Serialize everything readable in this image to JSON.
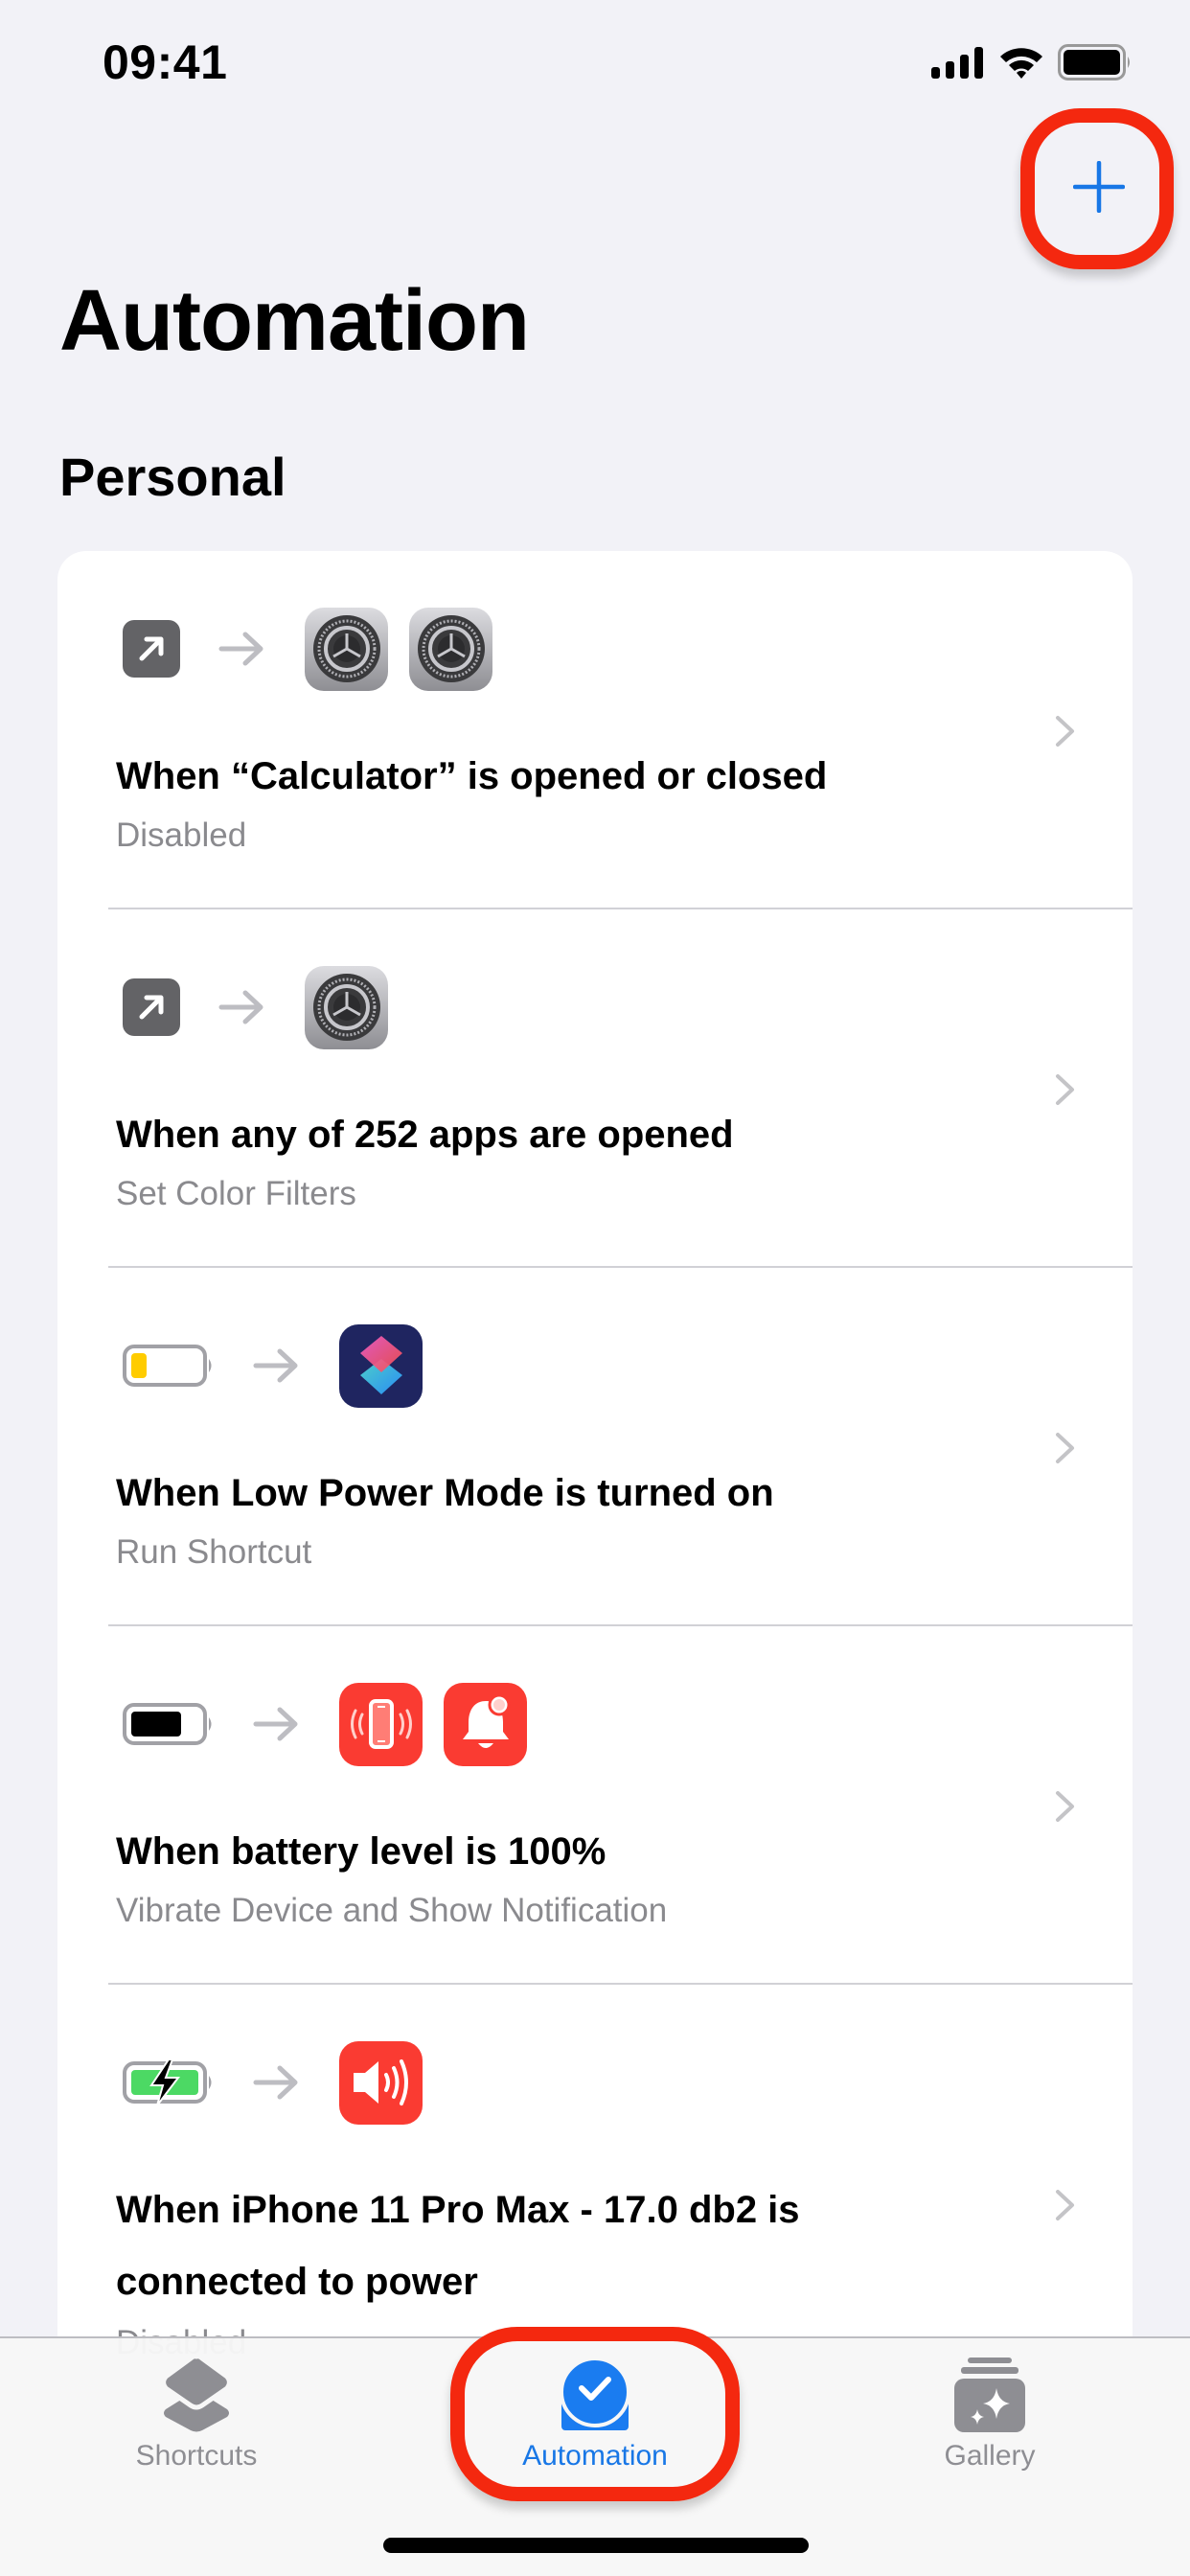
{
  "status_bar": {
    "time": "09:41",
    "icons": [
      "cellular-signal-icon",
      "wifi-icon",
      "battery-icon"
    ]
  },
  "header": {
    "add_button_icon": "plus-icon",
    "title": "Automation",
    "section": "Personal"
  },
  "colors": {
    "accent": "#1877e6",
    "highlight": "#f4280f",
    "background": "#f2f2f7",
    "subtitle": "#8a8a8e"
  },
  "automations": [
    {
      "trigger_icon": "app-open-arrow-icon",
      "action_icons": [
        "settings-app-icon",
        "settings-app-icon"
      ],
      "title": "When “Calculator” is opened or closed",
      "subtitle": "Disabled"
    },
    {
      "trigger_icon": "app-open-arrow-icon",
      "action_icons": [
        "settings-app-icon"
      ],
      "title": "When any of 252 apps are opened",
      "subtitle": "Set Color Filters"
    },
    {
      "trigger_icon": "low-battery-icon",
      "action_icons": [
        "shortcuts-app-icon"
      ],
      "title": "When Low Power Mode is turned on",
      "subtitle": "Run Shortcut"
    },
    {
      "trigger_icon": "full-battery-icon",
      "action_icons": [
        "vibrate-device-icon",
        "show-notification-icon"
      ],
      "title": "When battery level is 100%",
      "subtitle": "Vibrate Device and Show Notification"
    },
    {
      "trigger_icon": "charging-battery-icon",
      "action_icons": [
        "volume-icon"
      ],
      "title": "When iPhone 11 Pro Max - 17.0 db2 is connected to power",
      "subtitle": "Disabled"
    }
  ],
  "tab_bar": {
    "tabs": [
      {
        "label": "Shortcuts",
        "icon": "shortcuts-stack-icon",
        "active": false
      },
      {
        "label": "Automation",
        "icon": "automation-clock-check-icon",
        "active": true
      },
      {
        "label": "Gallery",
        "icon": "gallery-sparkle-icon",
        "active": false
      }
    ]
  }
}
